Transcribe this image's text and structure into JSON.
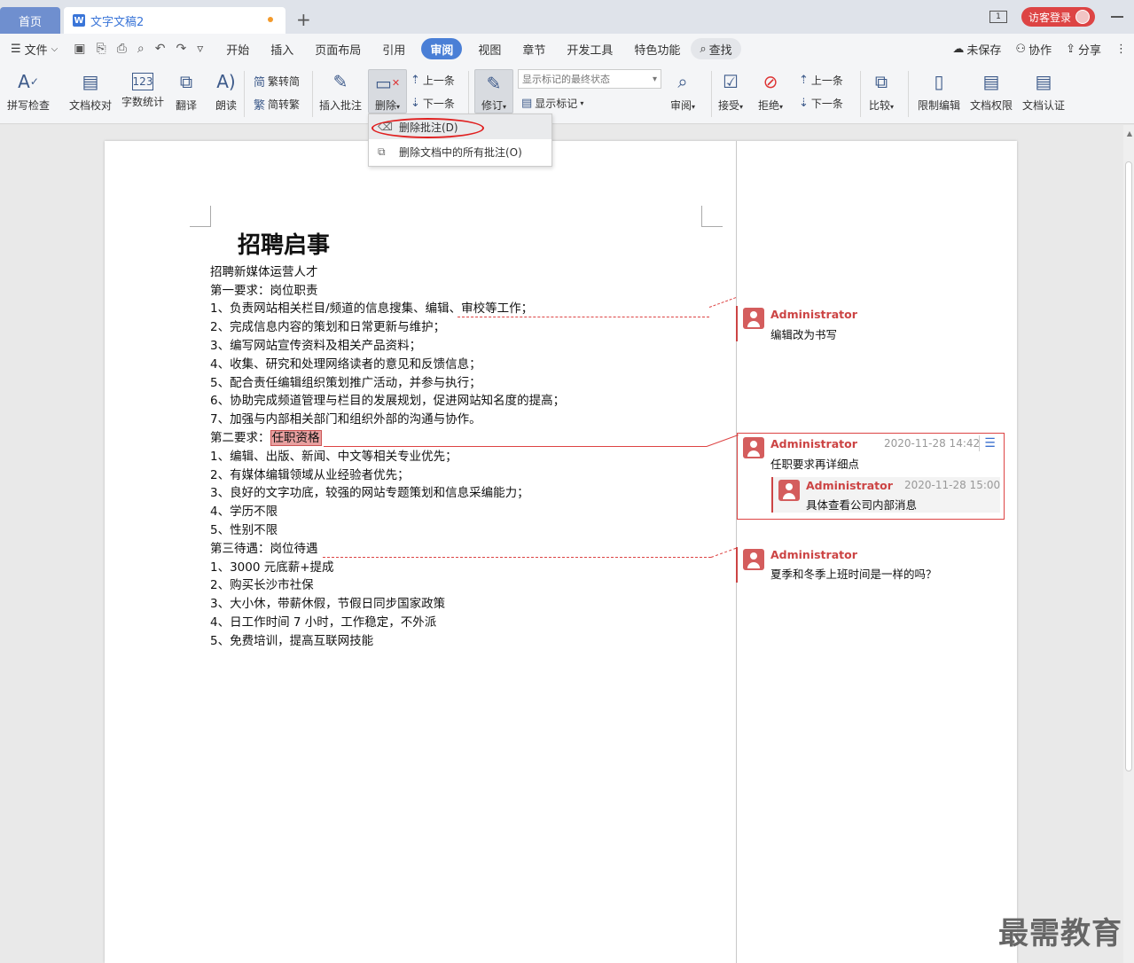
{
  "tabs": {
    "home": "首页",
    "doc_icon": "W",
    "doc_title": "文字文稿2",
    "add": "+"
  },
  "titlebar": {
    "page_icon": "1",
    "login": "访客登录"
  },
  "menu": {
    "file": "文件",
    "items": [
      "开始",
      "插入",
      "页面布局",
      "引用",
      "审阅",
      "视图",
      "章节",
      "开发工具",
      "特色功能"
    ],
    "find": "查找",
    "unsaved": "未保存",
    "collab": "协作",
    "share": "分享"
  },
  "ribbon": {
    "spell": "拼写检查",
    "proofread": "文档校对",
    "wordcount": "字数统计",
    "translate": "翻译",
    "read": "朗读",
    "trad": "繁转简",
    "simp": "简转繁",
    "insert_comment": "插入批注",
    "delete": "删除",
    "prev": "上一条",
    "next": "下一条",
    "revise": "修订",
    "markup_state": "显示标记的最终状态",
    "show_markup": "显示标记",
    "review": "审阅",
    "accept": "接受",
    "reject": "拒绝",
    "prev2": "上一条",
    "next2": "下一条",
    "compare": "比较",
    "restrict": "限制编辑",
    "permission": "文档权限",
    "certify": "文档认证"
  },
  "dropdown": {
    "delete_comment": "删除批注(D)",
    "delete_all": "删除文档中的所有批注(O)"
  },
  "document": {
    "title": "招聘启事",
    "lines": [
      "招聘新媒体运营人才",
      "第一要求：岗位职责",
      "1、负责网站相关栏目/频道的信息搜集、编辑、审校等工作；",
      "2、完成信息内容的策划和日常更新与维护；",
      "3、编写网站宣传资料及相关产品资料；",
      "4、收集、研究和处理网络读者的意见和反馈信息；",
      "5、配合责任编辑组织策划推广活动，并参与执行；",
      "6、协助完成频道管理与栏目的发展规划，促进网站知名度的提高；",
      "7、加强与内部相关部门和组织外部的沟通与协作。",
      "第二要求：",
      "1、编辑、出版、新闻、中文等相关专业优先；",
      "2、有媒体编辑领域从业经验者优先；",
      "3、良好的文字功底，较强的网站专题策划和信息采编能力；",
      "4、学历不限",
      "5、性别不限",
      "第三待遇：岗位待遇",
      "1、3000 元底薪+提成",
      "2、购买长沙市社保",
      "3、大小休，带薪休假，节假日同步国家政策",
      "4、日工作时间 7 小时，工作稳定，不外派",
      "5、免费培训，提高互联网技能"
    ],
    "highlighted": "任职资格"
  },
  "comments": [
    {
      "author": "Administrator",
      "text": "编辑改为书写"
    },
    {
      "author": "Administrator",
      "time": "2020-11-28 14:42",
      "text": "任职要求再详细点",
      "reply": {
        "author": "Administrator",
        "time": "2020-11-28 15:00",
        "text": "具体查看公司内部消息"
      }
    },
    {
      "author": "Administrator",
      "text": "夏季和冬季上班时间是一样的吗？"
    }
  ],
  "watermark": "最需教育",
  "colors": {
    "accent": "#4a7fd6",
    "comment": "#c44444",
    "highlight": "#e8a0a0"
  }
}
